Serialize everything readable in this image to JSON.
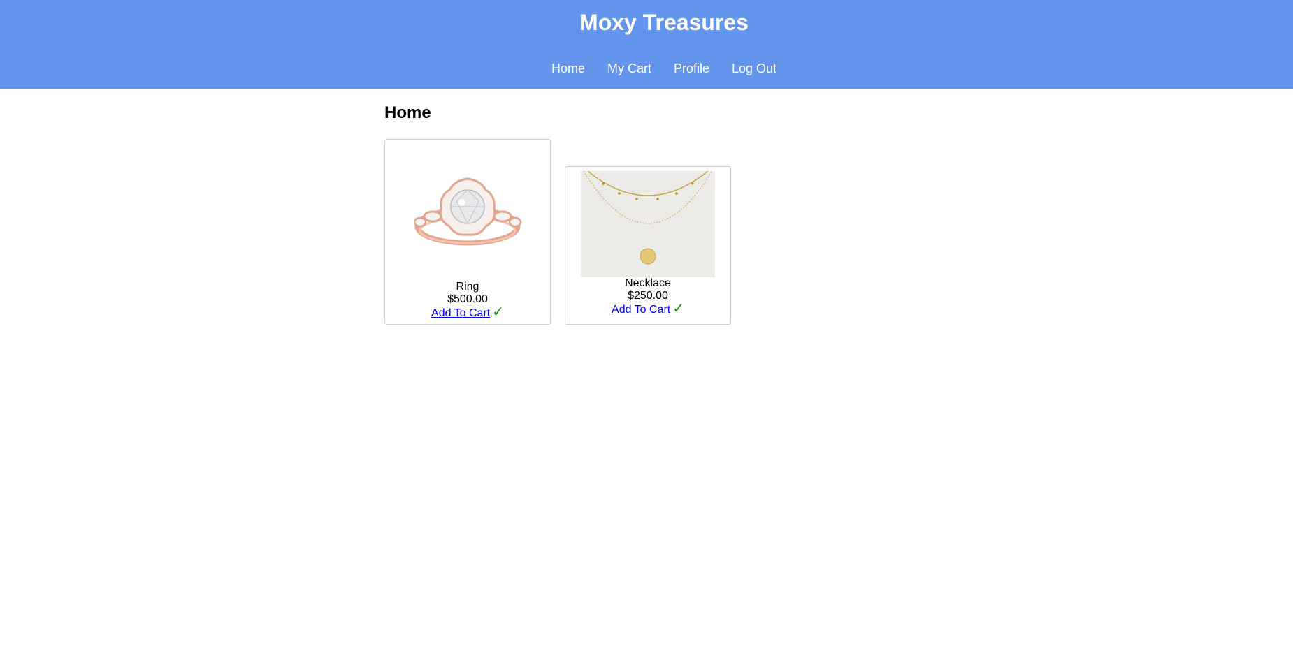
{
  "header": {
    "title": "Moxy Treasures",
    "nav": [
      {
        "label": "Home"
      },
      {
        "label": "My Cart"
      },
      {
        "label": "Profile"
      },
      {
        "label": "Log Out"
      }
    ],
    "background_color": "#6495ed"
  },
  "main": {
    "heading": "Home",
    "products": [
      {
        "name": "Ring",
        "price": "$500.00",
        "action_label": "Add To Cart",
        "status_icon": "checkmark-icon",
        "status_color": "#0a8a0a"
      },
      {
        "name": "Necklace",
        "price": "$250.00",
        "action_label": "Add To Cart",
        "status_icon": "checkmark-icon",
        "status_color": "#0a8a0a"
      }
    ],
    "link_color": "#0000ee"
  }
}
